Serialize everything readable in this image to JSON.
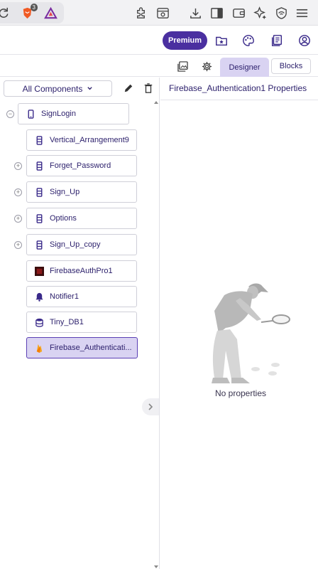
{
  "browser": {
    "brave_badge": "3",
    "icons": [
      "reload-icon",
      "brave-shields-icon",
      "brave-rewards-icon",
      "extensions-icon",
      "screenshot-icon",
      "download-icon",
      "sidebar-icon",
      "wallet-icon",
      "leo-ai-icon",
      "vpn-icon",
      "menu-icon"
    ]
  },
  "header": {
    "premium_label": "Premium",
    "icons": [
      "my-projects-icon",
      "gallery-icon",
      "guide-icon",
      "account-icon"
    ]
  },
  "toolbar": {
    "designer_label": "Designer",
    "blocks_label": "Blocks"
  },
  "components": {
    "filter_label": "All Components",
    "items": [
      {
        "label": "SignLogin",
        "icon": "phone-icon",
        "expander": "−"
      },
      {
        "label": "Vertical_Arrangement9",
        "icon": "vertical-arrangement-icon"
      },
      {
        "label": "Forget_Password",
        "icon": "vertical-arrangement-icon",
        "expander": "+"
      },
      {
        "label": "Sign_Up",
        "icon": "vertical-arrangement-icon",
        "expander": "+"
      },
      {
        "label": "Options",
        "icon": "vertical-arrangement-icon",
        "expander": "+"
      },
      {
        "label": "Sign_Up_copy",
        "icon": "vertical-arrangement-icon",
        "expander": "+"
      },
      {
        "label": "FirebaseAuthPro1",
        "icon": "extension-icon"
      },
      {
        "label": "Notifier1",
        "icon": "bell-icon"
      },
      {
        "label": "Tiny_DB1",
        "icon": "database-icon"
      },
      {
        "label": "Firebase_Authenticati...",
        "icon": "firebase-icon"
      }
    ]
  },
  "properties": {
    "title": "Firebase_Authentication1 Properties",
    "empty_label": "No properties"
  },
  "colors": {
    "accent": "#4a2fa0",
    "selected_bg": "#d9d3f2",
    "text": "#2b1f6b"
  }
}
